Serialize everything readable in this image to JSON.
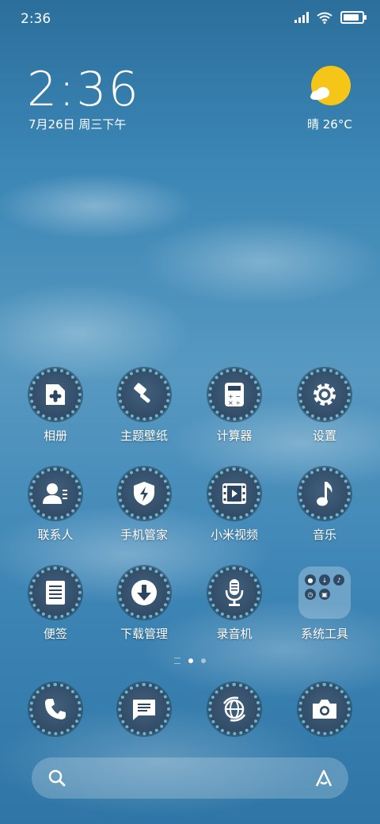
{
  "status_bar": {
    "time": "2:36",
    "battery_level": 0.85
  },
  "lock_widget": {
    "clock": "2:36",
    "date": "7月26日 周三下午"
  },
  "weather": {
    "text": "晴 26°C",
    "icon": "sun-cloud-icon",
    "sun_color": "#f5c518"
  },
  "apps_row1": [
    {
      "label": "相册",
      "icon": "gallery-icon"
    },
    {
      "label": "主题壁纸",
      "icon": "paintbrush-icon"
    },
    {
      "label": "计算器",
      "icon": "calculator-icon"
    },
    {
      "label": "设置",
      "icon": "gear-icon"
    }
  ],
  "apps_row2": [
    {
      "label": "联系人",
      "icon": "contacts-icon"
    },
    {
      "label": "手机管家",
      "icon": "shield-icon"
    },
    {
      "label": "小米视频",
      "icon": "video-icon"
    },
    {
      "label": "音乐",
      "icon": "music-note-icon"
    }
  ],
  "apps_row3": [
    {
      "label": "便签",
      "icon": "notepad-icon"
    },
    {
      "label": "下载管理",
      "icon": "download-icon"
    },
    {
      "label": "录音机",
      "icon": "microphone-icon"
    },
    {
      "label": "系统工具",
      "icon": "folder-icon"
    }
  ],
  "dock": [
    {
      "icon": "phone-icon"
    },
    {
      "icon": "message-icon"
    },
    {
      "icon": "browser-icon"
    },
    {
      "icon": "camera-icon"
    }
  ],
  "page_indicator": {
    "current": 1,
    "total": 2
  },
  "search_bar": {
    "icon": "search-icon",
    "assistant_icon": "assistant-icon"
  }
}
